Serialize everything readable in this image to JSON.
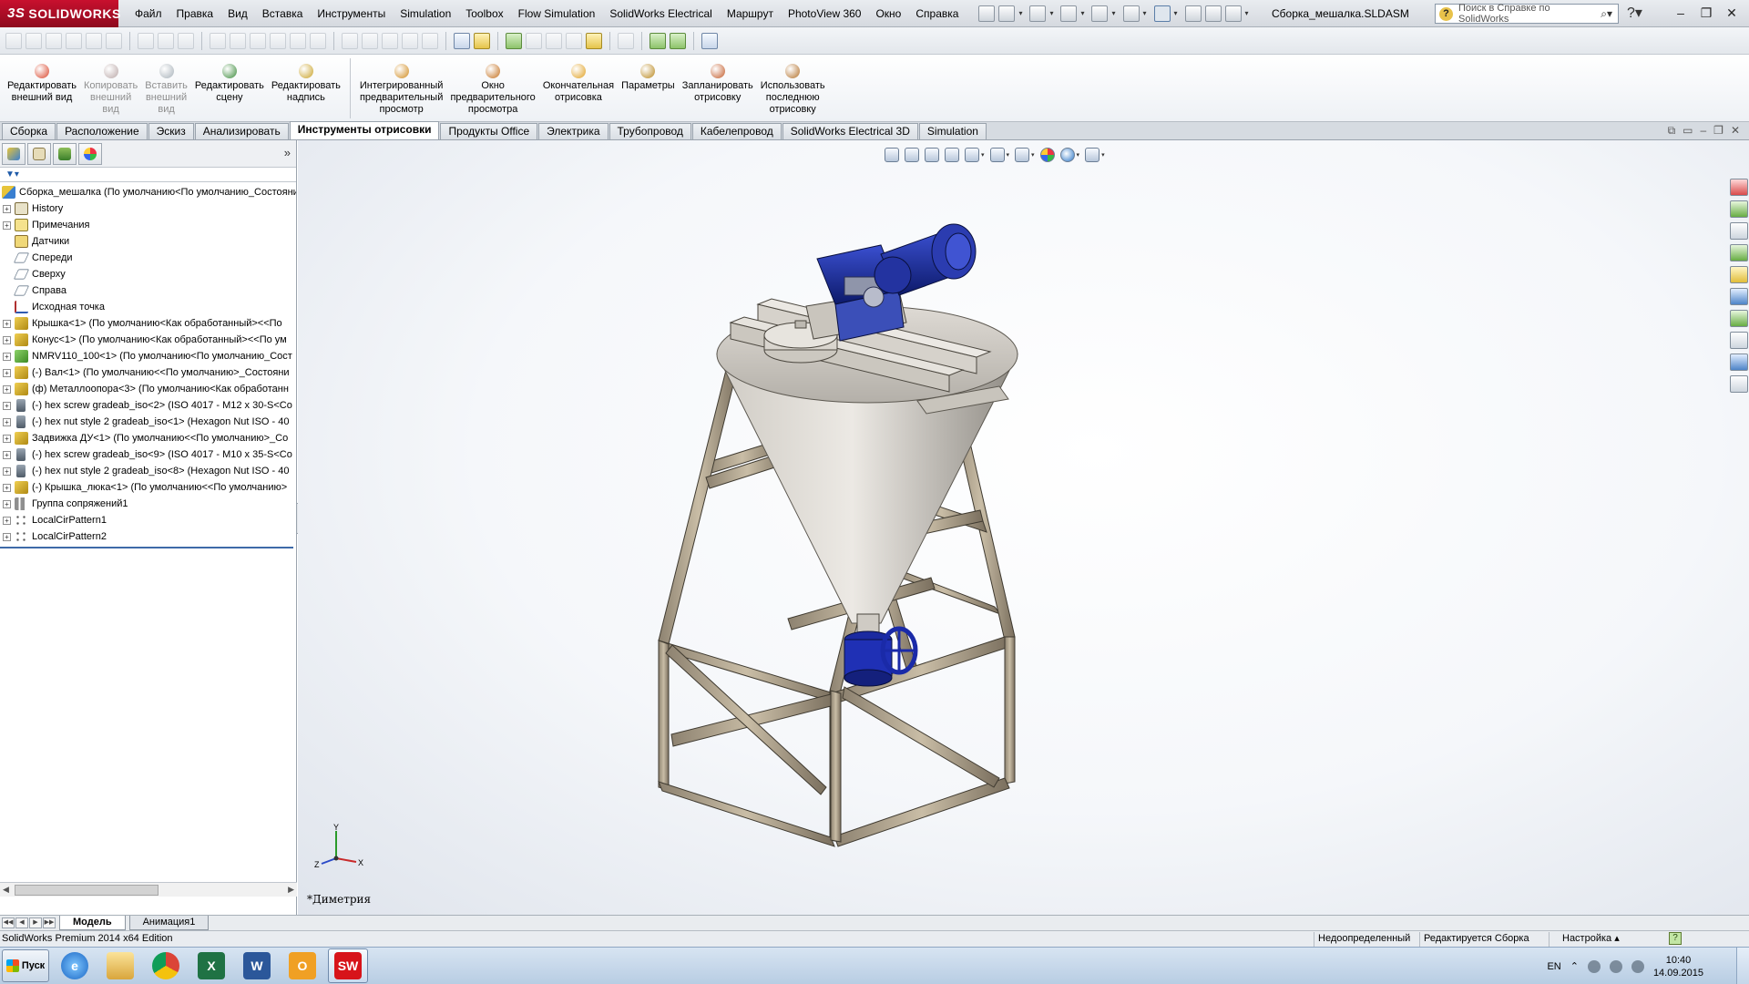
{
  "app": {
    "logo_text": "SOLIDWORKS",
    "document_title": "Сборка_мешалка.SLDASM",
    "help_search_placeholder": "Поиск в Справке по SolidWorks"
  },
  "menu": [
    "Файл",
    "Правка",
    "Вид",
    "Вставка",
    "Инструменты",
    "Simulation",
    "Toolbox",
    "Flow Simulation",
    "SolidWorks Electrical",
    "Маршрут",
    "PhotoView 360",
    "Окно",
    "Справка"
  ],
  "command_manager": [
    {
      "label": "Редактировать\nвнешний вид",
      "enabled": true,
      "color": "#d9452b"
    },
    {
      "label": "Копировать\nвнешний\nвид",
      "enabled": false,
      "color": "#b9a7a7"
    },
    {
      "label": "Вставить\nвнешний\nвид",
      "enabled": false,
      "color": "#a7b1b9"
    },
    {
      "label": "Редактировать\nсцену",
      "enabled": true,
      "color": "#3a8a3a"
    },
    {
      "label": "Редактировать\nнадпись",
      "enabled": true,
      "color": "#c9a227"
    },
    {
      "label": "Интегрированный\nпредварительный\nпросмотр",
      "enabled": true,
      "color": "#d08a1c"
    },
    {
      "label": "Окно\nпредварительного\nпросмотра",
      "enabled": true,
      "color": "#c4701e"
    },
    {
      "label": "Окончательная\nотрисовка",
      "enabled": true,
      "color": "#e0a020"
    },
    {
      "label": "Параметры",
      "enabled": true,
      "color": "#b8861b"
    },
    {
      "label": "Запланировать\nотрисовку",
      "enabled": true,
      "color": "#c25a28"
    },
    {
      "label": "Использовать\nпоследнюю\nотрисовку",
      "enabled": true,
      "color": "#b2702a"
    }
  ],
  "tabs": [
    {
      "label": "Сборка",
      "active": false
    },
    {
      "label": "Расположение",
      "active": false
    },
    {
      "label": "Эскиз",
      "active": false
    },
    {
      "label": "Анализировать",
      "active": false
    },
    {
      "label": "Инструменты отрисовки",
      "active": true
    },
    {
      "label": "Продукты Office",
      "active": false
    },
    {
      "label": "Электрика",
      "active": false
    },
    {
      "label": "Трубопровод",
      "active": false
    },
    {
      "label": "Кабелепровод",
      "active": false
    },
    {
      "label": "SolidWorks Electrical 3D",
      "active": false
    },
    {
      "label": "Simulation",
      "active": false
    }
  ],
  "feature_tree": [
    {
      "label": "Сборка_мешалка  (По умолчанию<По умолчанию_Состояние",
      "icon": "assy",
      "expand": "none",
      "root": true
    },
    {
      "label": "History",
      "icon": "hist",
      "expand": "+"
    },
    {
      "label": "Примечания",
      "icon": "ann",
      "expand": "+"
    },
    {
      "label": "Датчики",
      "icon": "sens",
      "expand": "none"
    },
    {
      "label": "Спереди",
      "icon": "plane",
      "expand": "none"
    },
    {
      "label": "Сверху",
      "icon": "plane",
      "expand": "none"
    },
    {
      "label": "Справа",
      "icon": "plane",
      "expand": "none"
    },
    {
      "label": "Исходная точка",
      "icon": "origin",
      "expand": "none"
    },
    {
      "label": "Крышка<1> (По умолчанию<Как обработанный><<По",
      "icon": "part",
      "expand": "+"
    },
    {
      "label": "Конус<1> (По умолчанию<Как обработанный><<По ум",
      "icon": "part",
      "expand": "+"
    },
    {
      "label": "NMRV110_100<1> (По умолчанию<По умолчанию_Сост",
      "icon": "green",
      "expand": "+"
    },
    {
      "label": "(-) Вал<1> (По умолчанию<<По умолчанию>_Состояни",
      "icon": "part",
      "expand": "+"
    },
    {
      "label": "(ф) Металлоопора<3> (По умолчанию<Как обработанн",
      "icon": "part",
      "expand": "+"
    },
    {
      "label": "(-) hex screw gradeab_iso<2> (ISO 4017 - M12 x 30-S<Co",
      "icon": "screw",
      "expand": "+"
    },
    {
      "label": "(-) hex nut style 2 gradeab_iso<1> (Hexagon Nut ISO - 40",
      "icon": "screw",
      "expand": "+"
    },
    {
      "label": "Задвижка ДУ<1> (По умолчанию<<По умолчанию>_Со",
      "icon": "part",
      "expand": "+"
    },
    {
      "label": "(-) hex screw gradeab_iso<9> (ISO 4017 - M10 x 35-S<Co",
      "icon": "screw",
      "expand": "+"
    },
    {
      "label": "(-) hex nut style 2 gradeab_iso<8> (Hexagon Nut ISO - 40",
      "icon": "screw",
      "expand": "+"
    },
    {
      "label": "(-) Крышка_люка<1> (По умолчанию<<По умолчанию>",
      "icon": "part",
      "expand": "+"
    },
    {
      "label": "Группа сопряжений1",
      "icon": "mates",
      "expand": "+"
    },
    {
      "label": "LocalCirPattern1",
      "icon": "pattern",
      "expand": "+"
    },
    {
      "label": "LocalCirPattern2",
      "icon": "pattern",
      "expand": "+"
    }
  ],
  "viewport": {
    "view_name": "*Диметрия",
    "triad": {
      "x": "X",
      "y": "Y",
      "z": "Z"
    }
  },
  "model_tabs": [
    {
      "label": "Модель",
      "active": true
    },
    {
      "label": "Анимация1",
      "active": false
    }
  ],
  "status": {
    "edition": "SolidWorks Premium 2014 x64 Edition",
    "definition": "Недоопределенный",
    "editing": "Редактируется Сборка",
    "settings": "Настройка",
    "help_icon": "?"
  },
  "taskbar": {
    "start_label": "Пуск",
    "apps": [
      {
        "name": "ie-icon",
        "glyph": "e",
        "cls": "ie",
        "active": false
      },
      {
        "name": "explorer-icon",
        "glyph": "",
        "cls": "fold",
        "active": false
      },
      {
        "name": "chrome-icon",
        "glyph": "",
        "cls": "chrome",
        "active": false
      },
      {
        "name": "excel-icon",
        "glyph": "X",
        "cls": "xl",
        "active": false
      },
      {
        "name": "word-icon",
        "glyph": "W",
        "cls": "wd",
        "active": false
      },
      {
        "name": "outlook-icon",
        "glyph": "O",
        "cls": "ol",
        "active": false
      },
      {
        "name": "solidworks-icon",
        "glyph": "SW",
        "cls": "sw",
        "active": true
      }
    ],
    "lang": "EN",
    "time": "10:40",
    "date": "14.09.2015"
  }
}
